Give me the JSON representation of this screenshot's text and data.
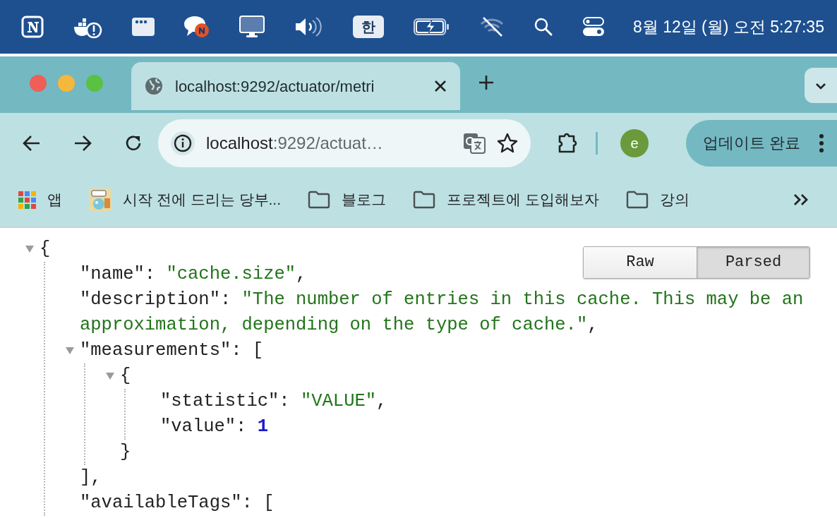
{
  "menu_bar": {
    "input_method": "한",
    "clock": "8월 12일 (월) 오전 5:27:35"
  },
  "tab": {
    "title": "localhost:9292/actuator/metri",
    "selected": true
  },
  "address_bar": {
    "host": "localhost",
    "path": ":9292/actuat…"
  },
  "profile": {
    "initial": "e"
  },
  "update_button": {
    "label": "업데이트 완료"
  },
  "bookmarks": [
    {
      "kind": "apps",
      "label": "앱"
    },
    {
      "kind": "page",
      "label": "시작 전에 드리는 당부..."
    },
    {
      "kind": "folder",
      "label": "블로그"
    },
    {
      "kind": "folder",
      "label": "프로젝트에 도입해보자"
    },
    {
      "kind": "folder",
      "label": "강의"
    }
  ],
  "view_toggle": [
    {
      "label": "Raw",
      "selected": false
    },
    {
      "label": "Parsed",
      "selected": true
    }
  ],
  "json_tree": {
    "kind": "block",
    "open": "{",
    "expanded": true,
    "children": [
      {
        "kind": "pair",
        "key": "\"name\":",
        "string": "\"cache.size\"",
        "tail": ","
      },
      {
        "kind": "pair",
        "key": "\"description\":",
        "string": "\"The number of entries in this cache. This may be an approximation, depending on the type of cache.\"",
        "tail": ","
      },
      {
        "kind": "block",
        "key": "\"measurements\":",
        "open": "[",
        "expanded": true,
        "close": "],",
        "children": [
          {
            "kind": "block",
            "open": "{",
            "expanded": true,
            "close": "}",
            "children": [
              {
                "kind": "pair",
                "key": "\"statistic\":",
                "string": "\"VALUE\"",
                "tail": ","
              },
              {
                "kind": "pair",
                "key": "\"value\":",
                "number": "1"
              }
            ]
          }
        ]
      },
      {
        "kind": "pair",
        "key": "\"availableTags\":",
        "bracket": "["
      }
    ]
  }
}
